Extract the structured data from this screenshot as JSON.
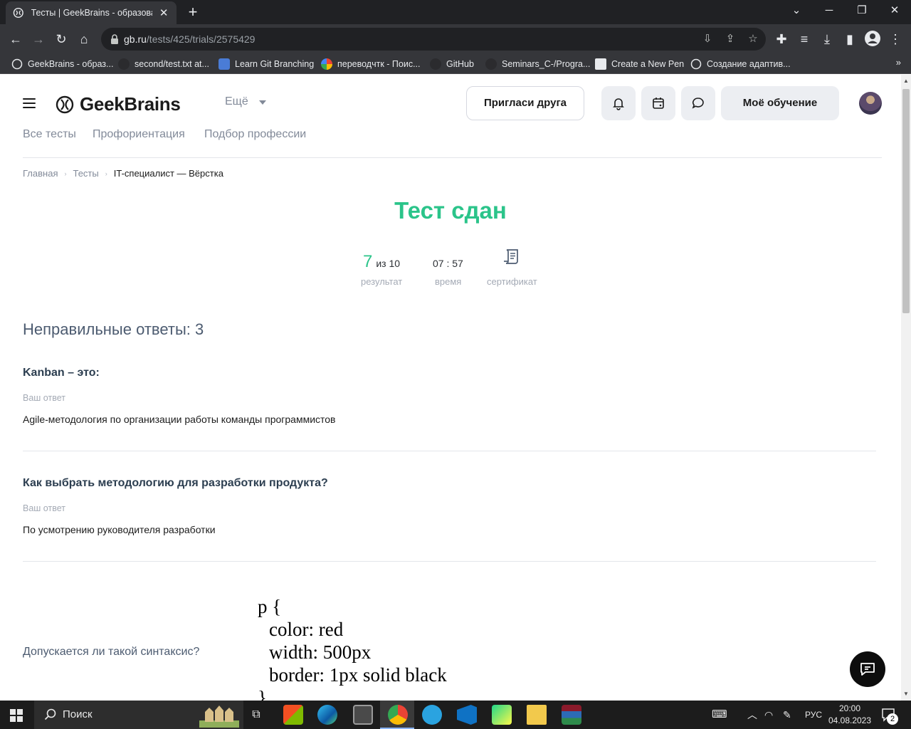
{
  "browser": {
    "tab_title": "Тесты | GeekBrains - образовате",
    "tab_close": "✕",
    "new_tab": "+",
    "url_host": "gb.ru",
    "url_path": "/tests/425/trials/2575429",
    "bookmarks": [
      "GeekBrains - образ...",
      "second/test.txt at...",
      "Learn Git Branching",
      "переводчтк - Поис...",
      "GitHub",
      "Seminars_C-/Progra...",
      "Create a New Pen",
      "Создание адаптив..."
    ],
    "bookmarks_more": "»"
  },
  "header": {
    "logo_text": "GeekBrains",
    "more_label": "Ещё",
    "invite_label": "Пригласи друга",
    "my_learning_label": "Моё обучение"
  },
  "subnav": [
    "Все тесты",
    "Профориентация",
    "Подбор профессии"
  ],
  "breadcrumbs": {
    "home": "Главная",
    "tests": "Тесты",
    "current": "IT-специалист — Вёрстка",
    "separator": "›"
  },
  "result": {
    "title": "Тест сдан",
    "score": "7",
    "score_total": "из 10",
    "score_label": "результат",
    "time": "07 : 57",
    "time_label": "время",
    "certificate_label": "сертификат",
    "accent_color": "#2bc48a"
  },
  "wrong": {
    "title": "Неправильные ответы: 3",
    "your_answer_label": "Ваш ответ",
    "questions": [
      {
        "question": "Kanban – это:",
        "answer": "Agile-методология по организации работы команды программистов"
      },
      {
        "question": "Как выбрать методологию для разработки продукта?",
        "answer": "По усмотрению руководителя разработки"
      },
      {
        "question": "Допускается ли такой синтаксис?",
        "code": [
          "p {",
          "color: red",
          "width: 500px",
          "border: 1px solid black",
          "}"
        ]
      }
    ]
  },
  "taskbar": {
    "search_label": "Поиск",
    "language": "РУС",
    "time": "20:00",
    "date": "04.08.2023",
    "notifications": "2"
  }
}
